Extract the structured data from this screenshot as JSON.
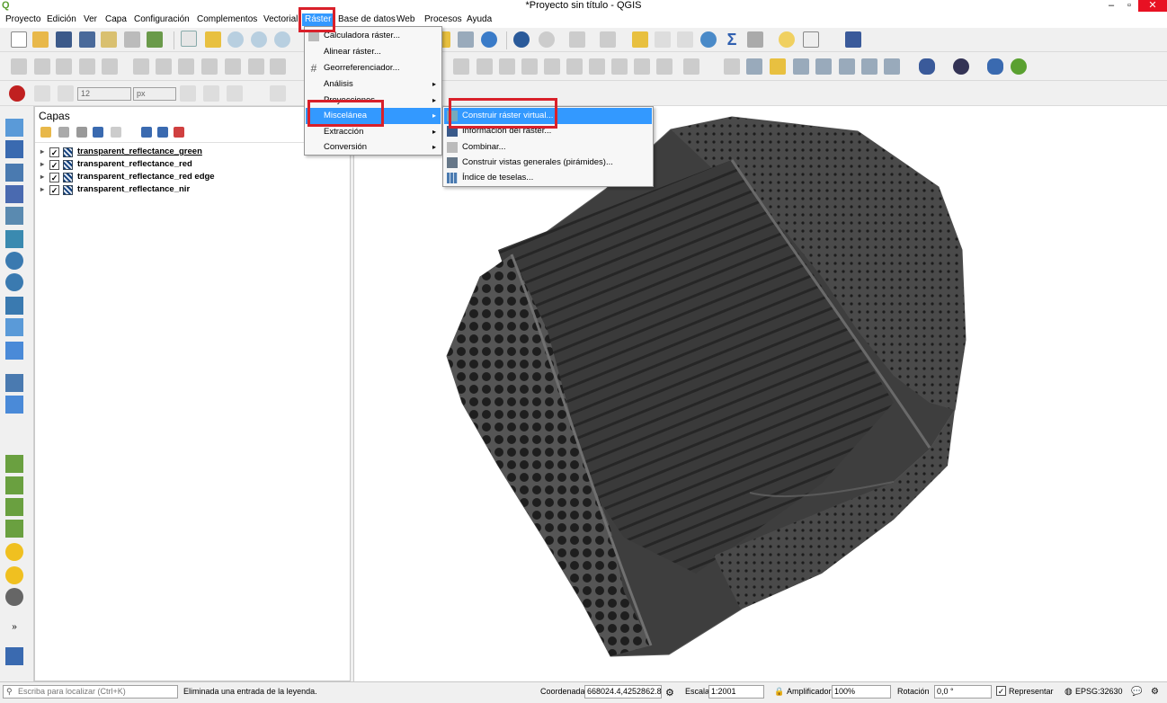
{
  "window": {
    "title": "*Proyecto sin título - QGIS",
    "minimize": "–",
    "maximize": "▫",
    "close": "✕",
    "logo": "Q"
  },
  "menubar": [
    "Proyecto",
    "Edición",
    "Ver",
    "Capa",
    "Configuración",
    "Complementos",
    "Vectorial",
    "Ráster",
    "Base de datos",
    "Web",
    "Procesos",
    "Ayuda"
  ],
  "raster_menu": {
    "items": [
      "Calculadora ráster...",
      "Alinear ráster...",
      "Georreferenciador...",
      "Análisis",
      "Proyecciones",
      "Miscelánea",
      "Extracción",
      "Conversión"
    ],
    "submenu_arrow": "▸"
  },
  "misc_submenu": {
    "items": [
      "Construir ráster virtual...",
      "Información del ráster...",
      "Combinar...",
      "Construir vistas generales (pirámides)...",
      "Índice de teselas..."
    ]
  },
  "snapping": {
    "size": "12",
    "unit": "px"
  },
  "layers_panel": {
    "title": "Capas",
    "layers": [
      "transparent_reflectance_green",
      "transparent_reflectance_red",
      "transparent_reflectance_red edge",
      "transparent_reflectance_nir"
    ]
  },
  "statusbar": {
    "search_placeholder": "Escriba para localizar (Ctrl+K)",
    "message": "Eliminada una entrada de la leyenda.",
    "coord_label": "Coordenada",
    "coord_value": "668024.4,4252862.8",
    "scale_label": "Escala",
    "scale_value": "1:2001",
    "magnifier_label": "Amplificador",
    "magnifier_value": "100%",
    "rotation_label": "Rotación",
    "rotation_value": "0,0 °",
    "render_label": "Representar",
    "crs": "EPSG:32630"
  },
  "colors": {
    "highlight": "#3399ff",
    "annotation_red": "#d9202a",
    "close_red": "#e81123"
  }
}
